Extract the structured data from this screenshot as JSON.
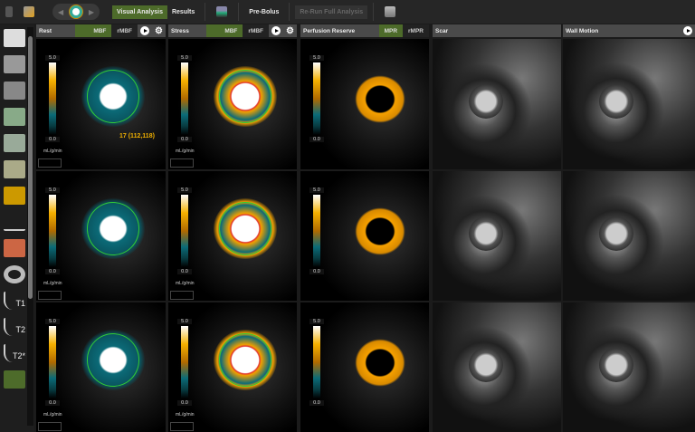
{
  "toolbar": {
    "visual_analysis": "Visual Analysis",
    "results": "Results",
    "pre_bolus": "Pre-Bolus",
    "rerun": "Re-Run Full Analysis",
    "nav_prev": "◀",
    "nav_next": "▶"
  },
  "sidebar": {
    "icons": [
      "layout-1x1-icon",
      "layout-grid-icon",
      "layout-series-icon",
      "volume-icon",
      "cube-icon",
      "segment-3d-icon",
      "segment-orange-icon",
      "curve-icon",
      "vessel-icon",
      "ring-icon",
      "t1-icon",
      "t2-icon",
      "t2star-icon",
      "perfusion-icon"
    ],
    "t1": "T1",
    "t2": "T2",
    "t2star": "T2*"
  },
  "columns": [
    {
      "title": "Rest",
      "buttons": [
        "MBF",
        "rMBF"
      ],
      "active": "MBF",
      "play": true,
      "gear": true,
      "colorbar": true,
      "unit": "mL/g/min"
    },
    {
      "title": "Stress",
      "buttons": [
        "MBF",
        "rMBF"
      ],
      "active": "MBF",
      "play": true,
      "gear": true,
      "colorbar": true,
      "unit": "mL/g/min"
    },
    {
      "title": "Perfusion Reserve",
      "buttons": [
        "MPR",
        "rMPR"
      ],
      "active": "MPR",
      "play": false,
      "gear": false,
      "colorbar": true,
      "unit": ""
    },
    {
      "title": "Scar",
      "buttons": [],
      "play": false,
      "gear": false,
      "colorbar": false
    },
    {
      "title": "Wall Motion",
      "buttons": [],
      "play": true,
      "gear": false,
      "colorbar": false
    }
  ],
  "colorbar": {
    "max": "5.0",
    "min": "0.0"
  },
  "annotation": "17 (112,118)",
  "colors": {
    "accent": "#4d6b2a",
    "header": "#4a4a4a",
    "orange": "#f5a000",
    "teal": "#0b6b78"
  }
}
